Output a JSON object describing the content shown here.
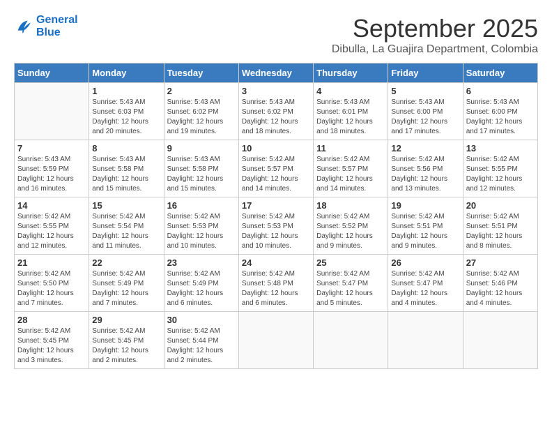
{
  "logo": {
    "line1": "General",
    "line2": "Blue"
  },
  "title": "September 2025",
  "subtitle": "Dibulla, La Guajira Department, Colombia",
  "weekdays": [
    "Sunday",
    "Monday",
    "Tuesday",
    "Wednesday",
    "Thursday",
    "Friday",
    "Saturday"
  ],
  "weeks": [
    [
      {
        "day": "",
        "info": ""
      },
      {
        "day": "1",
        "info": "Sunrise: 5:43 AM\nSunset: 6:03 PM\nDaylight: 12 hours\nand 20 minutes."
      },
      {
        "day": "2",
        "info": "Sunrise: 5:43 AM\nSunset: 6:02 PM\nDaylight: 12 hours\nand 19 minutes."
      },
      {
        "day": "3",
        "info": "Sunrise: 5:43 AM\nSunset: 6:02 PM\nDaylight: 12 hours\nand 18 minutes."
      },
      {
        "day": "4",
        "info": "Sunrise: 5:43 AM\nSunset: 6:01 PM\nDaylight: 12 hours\nand 18 minutes."
      },
      {
        "day": "5",
        "info": "Sunrise: 5:43 AM\nSunset: 6:00 PM\nDaylight: 12 hours\nand 17 minutes."
      },
      {
        "day": "6",
        "info": "Sunrise: 5:43 AM\nSunset: 6:00 PM\nDaylight: 12 hours\nand 17 minutes."
      }
    ],
    [
      {
        "day": "7",
        "info": "Sunrise: 5:43 AM\nSunset: 5:59 PM\nDaylight: 12 hours\nand 16 minutes."
      },
      {
        "day": "8",
        "info": "Sunrise: 5:43 AM\nSunset: 5:58 PM\nDaylight: 12 hours\nand 15 minutes."
      },
      {
        "day": "9",
        "info": "Sunrise: 5:43 AM\nSunset: 5:58 PM\nDaylight: 12 hours\nand 15 minutes."
      },
      {
        "day": "10",
        "info": "Sunrise: 5:42 AM\nSunset: 5:57 PM\nDaylight: 12 hours\nand 14 minutes."
      },
      {
        "day": "11",
        "info": "Sunrise: 5:42 AM\nSunset: 5:57 PM\nDaylight: 12 hours\nand 14 minutes."
      },
      {
        "day": "12",
        "info": "Sunrise: 5:42 AM\nSunset: 5:56 PM\nDaylight: 12 hours\nand 13 minutes."
      },
      {
        "day": "13",
        "info": "Sunrise: 5:42 AM\nSunset: 5:55 PM\nDaylight: 12 hours\nand 12 minutes."
      }
    ],
    [
      {
        "day": "14",
        "info": "Sunrise: 5:42 AM\nSunset: 5:55 PM\nDaylight: 12 hours\nand 12 minutes."
      },
      {
        "day": "15",
        "info": "Sunrise: 5:42 AM\nSunset: 5:54 PM\nDaylight: 12 hours\nand 11 minutes."
      },
      {
        "day": "16",
        "info": "Sunrise: 5:42 AM\nSunset: 5:53 PM\nDaylight: 12 hours\nand 10 minutes."
      },
      {
        "day": "17",
        "info": "Sunrise: 5:42 AM\nSunset: 5:53 PM\nDaylight: 12 hours\nand 10 minutes."
      },
      {
        "day": "18",
        "info": "Sunrise: 5:42 AM\nSunset: 5:52 PM\nDaylight: 12 hours\nand 9 minutes."
      },
      {
        "day": "19",
        "info": "Sunrise: 5:42 AM\nSunset: 5:51 PM\nDaylight: 12 hours\nand 9 minutes."
      },
      {
        "day": "20",
        "info": "Sunrise: 5:42 AM\nSunset: 5:51 PM\nDaylight: 12 hours\nand 8 minutes."
      }
    ],
    [
      {
        "day": "21",
        "info": "Sunrise: 5:42 AM\nSunset: 5:50 PM\nDaylight: 12 hours\nand 7 minutes."
      },
      {
        "day": "22",
        "info": "Sunrise: 5:42 AM\nSunset: 5:49 PM\nDaylight: 12 hours\nand 7 minutes."
      },
      {
        "day": "23",
        "info": "Sunrise: 5:42 AM\nSunset: 5:49 PM\nDaylight: 12 hours\nand 6 minutes."
      },
      {
        "day": "24",
        "info": "Sunrise: 5:42 AM\nSunset: 5:48 PM\nDaylight: 12 hours\nand 6 minutes."
      },
      {
        "day": "25",
        "info": "Sunrise: 5:42 AM\nSunset: 5:47 PM\nDaylight: 12 hours\nand 5 minutes."
      },
      {
        "day": "26",
        "info": "Sunrise: 5:42 AM\nSunset: 5:47 PM\nDaylight: 12 hours\nand 4 minutes."
      },
      {
        "day": "27",
        "info": "Sunrise: 5:42 AM\nSunset: 5:46 PM\nDaylight: 12 hours\nand 4 minutes."
      }
    ],
    [
      {
        "day": "28",
        "info": "Sunrise: 5:42 AM\nSunset: 5:45 PM\nDaylight: 12 hours\nand 3 minutes."
      },
      {
        "day": "29",
        "info": "Sunrise: 5:42 AM\nSunset: 5:45 PM\nDaylight: 12 hours\nand 2 minutes."
      },
      {
        "day": "30",
        "info": "Sunrise: 5:42 AM\nSunset: 5:44 PM\nDaylight: 12 hours\nand 2 minutes."
      },
      {
        "day": "",
        "info": ""
      },
      {
        "day": "",
        "info": ""
      },
      {
        "day": "",
        "info": ""
      },
      {
        "day": "",
        "info": ""
      }
    ]
  ]
}
